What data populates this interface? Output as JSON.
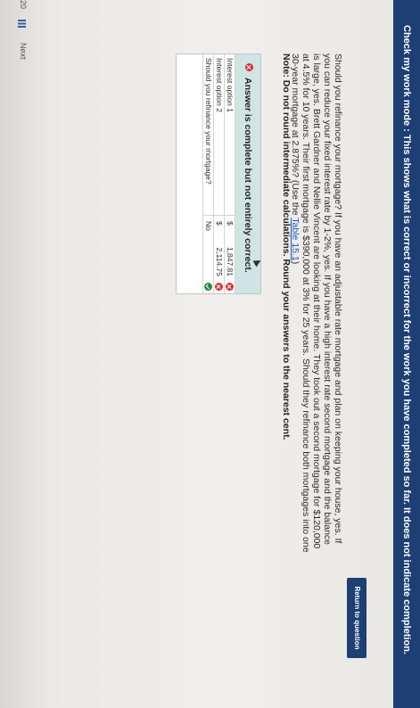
{
  "banner": {
    "text": "Check my work mode : This shows what is correct or incorrect for the work you have completed so far. It does not indicate completion."
  },
  "return_button": {
    "label": "Return to question"
  },
  "question": {
    "text": "Should you refinance your mortgage? If you have an adjustable rate mortgage and plan on keeping your house, yes. If you can reduce your fixed interest rate by 1-2%, yes. If you have a high interest rate second mortgage and the balance is large, yes. Brett Gardner and Nellie Vincent are looking at their home. They took out a second mortgage for $120,000 at 4.5% for 10 years. Their first mortgage is $390,000 at 3% for 25 years. Should they refinance both mortgages into one 30-year mortgage at 2.875%? (Use the ",
    "link": "Table 15.1",
    "suffix": ")",
    "note": "Note: Do not round intermediate calculations. Round your answers to the nearest cent."
  },
  "answer": {
    "status": "Answer is complete but not entirely correct.",
    "rows": [
      {
        "label": "Interest option 1",
        "symbol": "$",
        "value": "1,847.81",
        "mark": "incorrect"
      },
      {
        "label": "Interest option 2",
        "symbol": "$",
        "value": "2,114.75",
        "mark": "incorrect"
      },
      {
        "label": "Should you refinance your mortgage?",
        "value": "No",
        "mark": "correct"
      }
    ]
  },
  "pager": {
    "page": "20",
    "next_label": "Next"
  },
  "colors": {
    "banner_bg": "#1d3f73",
    "status_bg": "#cfe5e4",
    "incorrect": "#d83131",
    "correct": "#2b8a3e",
    "link": "#1a56c9"
  }
}
